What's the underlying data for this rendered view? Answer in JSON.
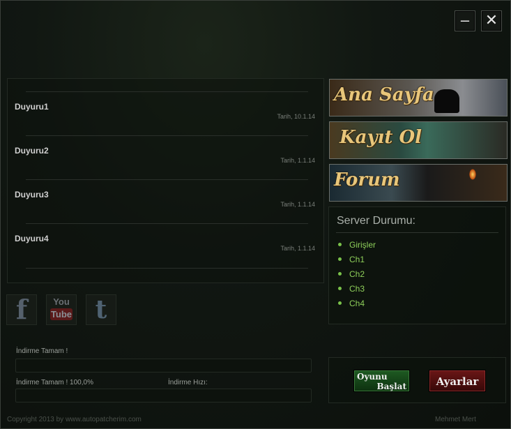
{
  "window": {
    "minimize_label": "–",
    "close_label": "✕"
  },
  "news": [
    {
      "title": "Duyuru1",
      "date": "Tarih, 10.1.14"
    },
    {
      "title": "Duyuru2",
      "date": "Tarih, 1.1.14"
    },
    {
      "title": "Duyuru3",
      "date": "Tarih, 1.1.14"
    },
    {
      "title": "Duyuru4",
      "date": "Tarih, 1.1.14"
    }
  ],
  "social": {
    "facebook": "f",
    "youtube_top": "You",
    "youtube_bottom": "Tube",
    "twitter": "t"
  },
  "download": {
    "status_label": "İndirme Tamam !",
    "progress_label": "İndirme Tamam ! 100,0%",
    "speed_label": "İndirme Hızı:"
  },
  "banners": {
    "home": "Ana Sayfa",
    "register": "Kayıt Ol",
    "forum": "Forum"
  },
  "server": {
    "title": "Server Durumu:",
    "items": [
      "Girişler",
      "Ch1",
      "Ch2",
      "Ch3",
      "Ch4"
    ]
  },
  "buttons": {
    "start_line1": "Oyunu",
    "start_line2": "Başlat",
    "settings": "Ayarlar"
  },
  "footer": {
    "copyright": "Copyright 2013 by www.autopatcherim.com",
    "author": "Mehmet Mert"
  },
  "colors": {
    "accent_green": "#7ac24a",
    "banner_gold": "#e8c67a",
    "start_green": "#1e5a22",
    "settings_red": "#6a1616"
  }
}
